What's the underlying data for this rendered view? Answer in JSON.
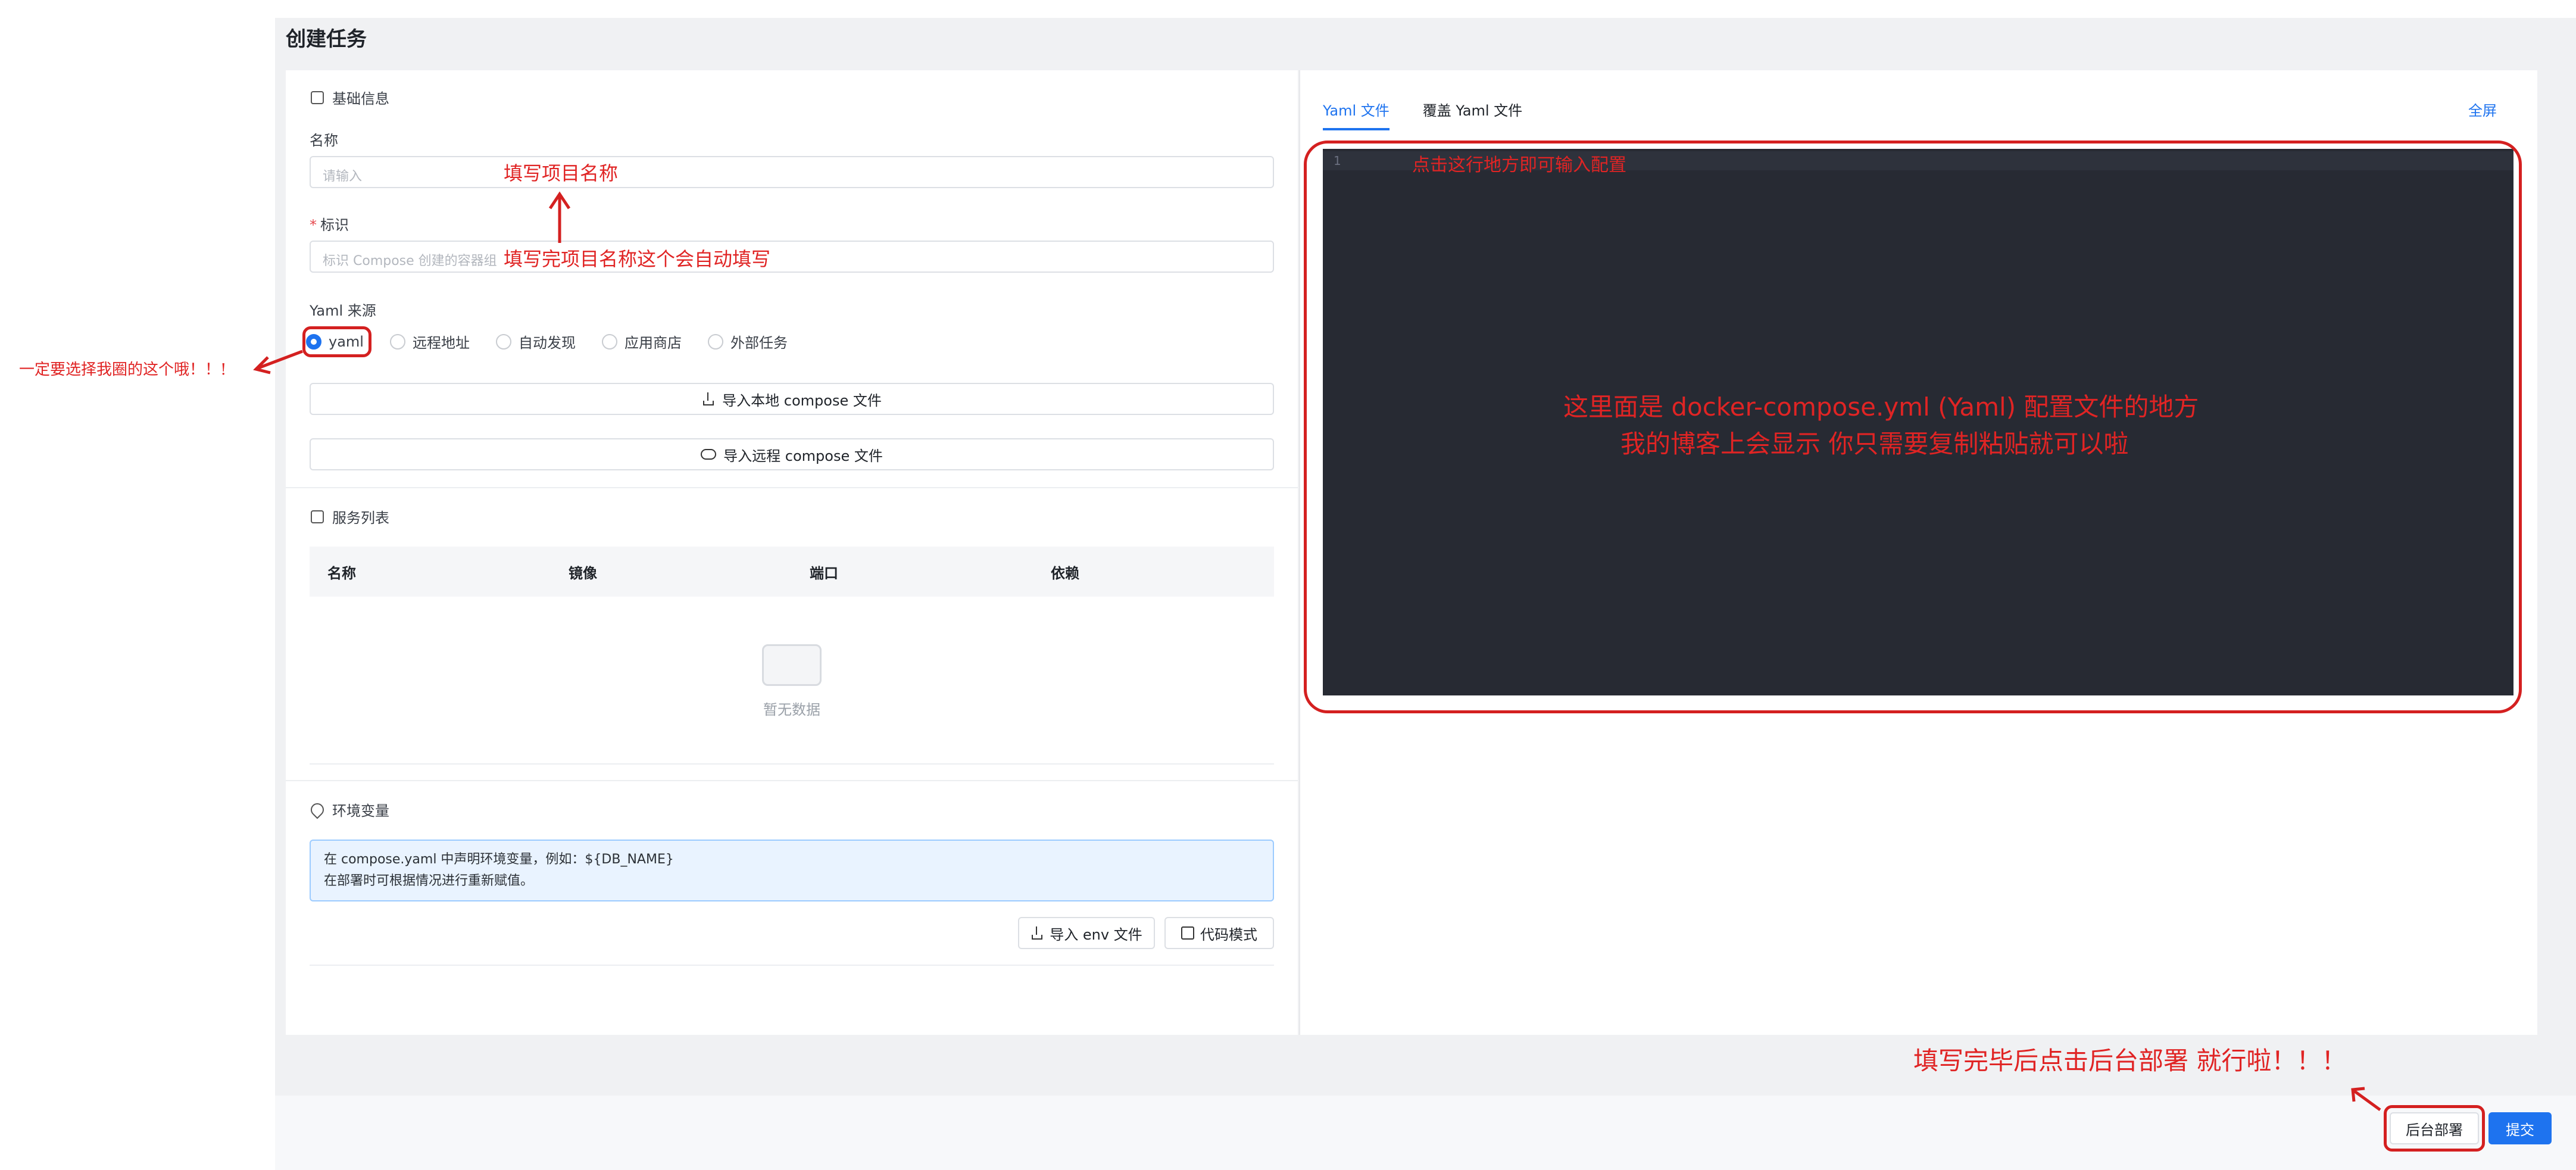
{
  "page": {
    "title": "创建任务"
  },
  "basic": {
    "section_title": "基础信息",
    "name_label": "名称",
    "name_placeholder": "请输入",
    "id_required": "*",
    "id_label": "标识",
    "id_placeholder": "标识 Compose 创建的容器组",
    "yaml_source_label": "Yaml 来源",
    "sources": [
      {
        "label": "yaml",
        "selected": true
      },
      {
        "label": "远程地址",
        "selected": false
      },
      {
        "label": "自动发现",
        "selected": false
      },
      {
        "label": "应用商店",
        "selected": false
      },
      {
        "label": "外部任务",
        "selected": false
      }
    ],
    "import_local": "导入本地 compose 文件",
    "import_remote": "导入远程 compose 文件"
  },
  "services": {
    "section_title": "服务列表",
    "columns": [
      "名称",
      "镜像",
      "端口",
      "依赖"
    ],
    "empty_text": "暂无数据"
  },
  "env": {
    "section_title": "环境变量",
    "note_line1": "在 compose.yaml 中声明环境变量，例如：${DB_NAME}",
    "note_line2": "在部署时可根据情况进行重新赋值。",
    "import_env": "导入 env 文件",
    "code_mode": "代码模式"
  },
  "editor": {
    "tabs": [
      "Yaml 文件",
      "覆盖 Yaml 文件"
    ],
    "active_tab": 0,
    "fullscreen": "全屏",
    "line_number": "1"
  },
  "footer": {
    "background_deploy": "后台部署",
    "submit": "提交"
  },
  "annotations": {
    "name_hint": "填写项目名称",
    "id_hint": "填写完项目名称这个会自动填写",
    "yaml_hint": "一定要选择我圈的这个哦！！!",
    "editor_click_hint": "点击这行地方即可输入配置",
    "editor_line1": "这里面是 docker-compose.yml (Yaml) 配置文件的地方",
    "editor_line2": "我的博客上会显示 你只需要复制粘贴就可以啦",
    "deploy_hint": "填写完毕后点击后台部署 就行啦！！！"
  },
  "colors": {
    "accent": "#1e73ef",
    "annotation": "#e02424",
    "editor_bg": "#272a33"
  }
}
